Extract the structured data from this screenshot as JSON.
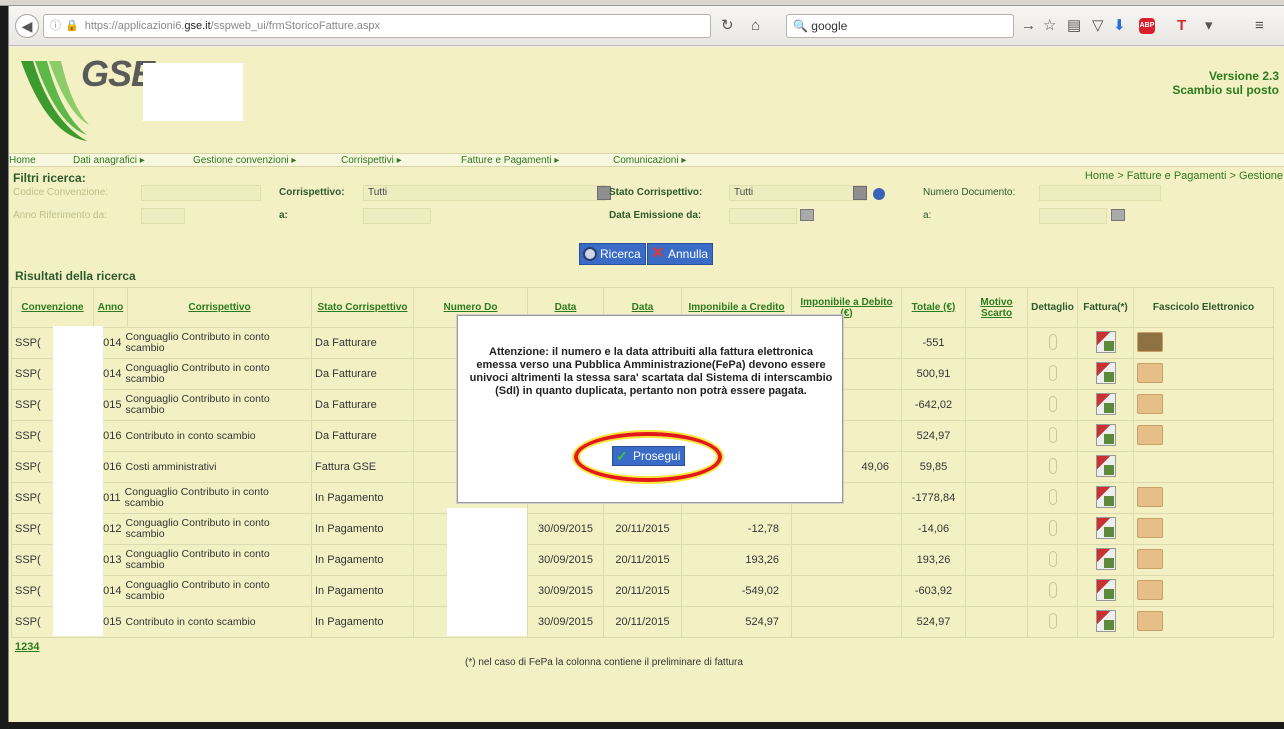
{
  "browser": {
    "url_prefix": "https://applicazioni6.",
    "url_domain": "gse.it",
    "url_path": "/sspweb_ui/frmStoricoFatture.aspx",
    "search_value": "google"
  },
  "header": {
    "logo_text": "GSE",
    "version_line1": "Versione 2.3",
    "version_line2": "Scambio sul posto"
  },
  "menu": {
    "items": [
      "Home",
      "Dati anagrafici ▸",
      "Gestione convenzioni ▸",
      "Corrispettivi ▸",
      "Fatture e Pagamenti ▸",
      "Comunicazioni ▸"
    ]
  },
  "breadcrumb": "Home > Fatture e Pagamenti > Gestione",
  "filters": {
    "title": "Filtri ricerca:",
    "codice_label": "Codice Convenzione:",
    "corrispettivo_label": "Corrispettivo:",
    "corrispettivo_value": "Tutti",
    "stato_label": "Stato Corrispettivo:",
    "stato_value": "Tutti",
    "numero_doc_label": "Numero Documento:",
    "anno_label": "Anno Riferimento da:",
    "a_label": "a:",
    "data_emissione_label": "Data Emissione da:",
    "a2_label": "a:"
  },
  "buttons": {
    "search": "Ricerca",
    "cancel": "Annulla"
  },
  "results": {
    "title": "Risultati della ricerca",
    "columns": [
      "Convenzione",
      "Anno",
      "Corrispettivo",
      "Stato Corrispettivo",
      "Numero Do",
      "Data",
      "Data",
      "Imponibile a Credito",
      "Imponibile a Debito (€)",
      "Totale (€)",
      "Motivo Scarto",
      "Dettaglio",
      "Fattura(*)",
      "Fascicolo Elettronico"
    ],
    "rows": [
      {
        "conv": "SSP(",
        "anno": "2014",
        "corr": "Conguaglio Contributo in conto scambio",
        "stato": "Da Fatturare",
        "data1": "",
        "data2": "",
        "cred": "",
        "deb": "",
        "tot": "-551"
      },
      {
        "conv": "SSP(",
        "anno": "2014",
        "corr": "Conguaglio Contributo in conto scambio",
        "stato": "Da Fatturare",
        "data1": "",
        "data2": "",
        "cred": "",
        "deb": "",
        "tot": "500,91"
      },
      {
        "conv": "SSP(",
        "anno": "2015",
        "corr": "Conguaglio Contributo in conto scambio",
        "stato": "Da Fatturare",
        "data1": "",
        "data2": "",
        "cred": "",
        "deb": "",
        "tot": "-642,02"
      },
      {
        "conv": "SSP(",
        "anno": "2016",
        "corr": "Contributo in conto scambio",
        "stato": "Da Fatturare",
        "data1": "",
        "data2": "",
        "cred": "",
        "deb": "",
        "tot": "524,97"
      },
      {
        "conv": "SSP(",
        "anno": "2016",
        "corr": "Costi amministrativi",
        "stato": "Fattura GSE",
        "data1": "",
        "data2": "",
        "cred": "",
        "deb": "49,06",
        "tot": "59,85"
      },
      {
        "conv": "SSP(",
        "anno": "2011",
        "corr": "Conguaglio Contributo in conto scambio",
        "stato": "In Pagamento",
        "data1": "",
        "data2": "",
        "cred": "",
        "deb": "",
        "tot": "-1778,84"
      },
      {
        "conv": "SSP(",
        "anno": "2012",
        "corr": "Conguaglio Contributo in conto scambio",
        "stato": "In Pagamento",
        "data1": "30/09/2015",
        "data2": "20/11/2015",
        "cred": "-12,78",
        "deb": "",
        "tot": "-14,06"
      },
      {
        "conv": "SSP(",
        "anno": "2013",
        "corr": "Conguaglio Contributo in conto scambio",
        "stato": "In Pagamento",
        "data1": "30/09/2015",
        "data2": "20/11/2015",
        "cred": "193,26",
        "deb": "",
        "tot": "193,26"
      },
      {
        "conv": "SSP(",
        "anno": "2014",
        "corr": "Conguaglio Contributo in conto scambio",
        "stato": "In Pagamento",
        "data1": "30/09/2015",
        "data2": "20/11/2015",
        "cred": "-549,02",
        "deb": "",
        "tot": "-603,92"
      },
      {
        "conv": "SSP(",
        "anno": "2015",
        "corr": "Contributo in conto scambio",
        "stato": "In Pagamento",
        "data1": "30/09/2015",
        "data2": "20/11/2015",
        "cred": "524,97",
        "deb": "",
        "tot": "524,97"
      }
    ],
    "pages": "1234",
    "footnote": "(*) nel caso di FePa la colonna contiene il preliminare di fattura"
  },
  "modal": {
    "message": "Attenzione: il numero e la data attribuiti alla fattura elettronica emessa verso una Pubblica Amministrazione(FePa) devono essere univoci altrimenti la stessa sara' scartata dal Sistema di interscambio (SdI) in quanto duplicata, pertanto non potrà essere pagata.",
    "button": "Prosegui"
  },
  "colors": {
    "page_bg": "#f3f1c4",
    "link_green": "#2d7a1f",
    "button_blue": "#3a6cc7",
    "highlight_red": "#e41818"
  }
}
